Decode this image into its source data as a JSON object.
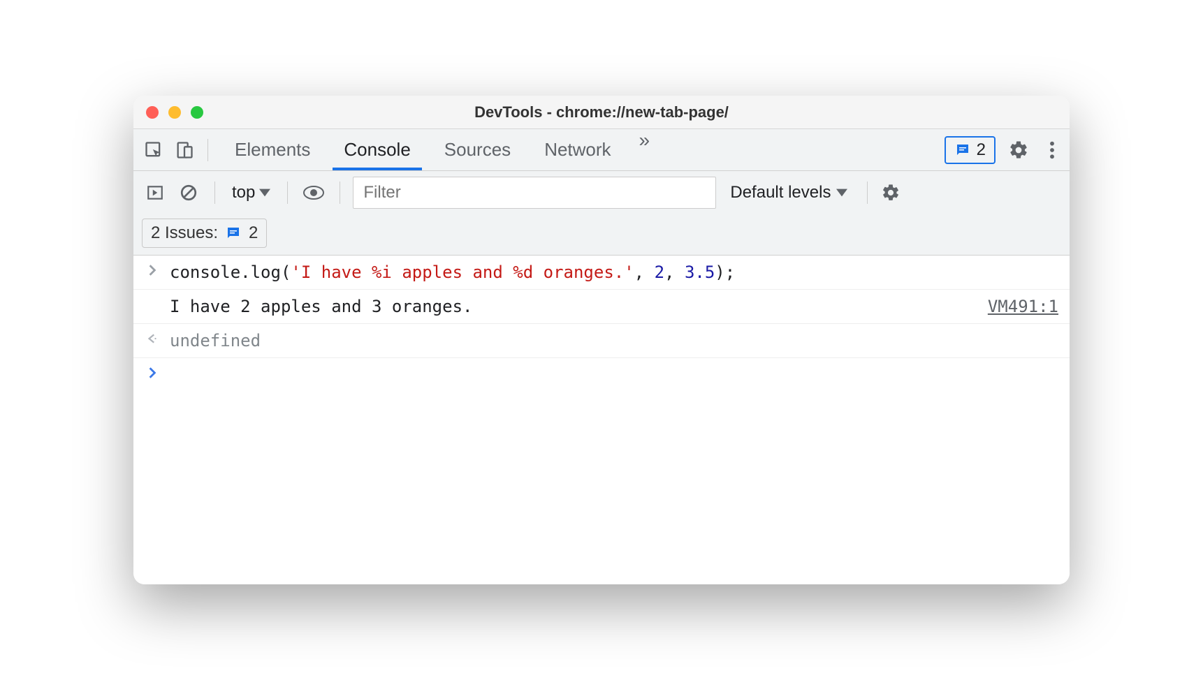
{
  "window": {
    "title": "DevTools - chrome://new-tab-page/"
  },
  "tabs": {
    "elements": "Elements",
    "console": "Console",
    "sources": "Sources",
    "network": "Network",
    "overflow": "»"
  },
  "issues_badge": {
    "count": "2"
  },
  "console_toolbar": {
    "context": "top",
    "filter_placeholder": "Filter",
    "levels_label": "Default levels"
  },
  "issues_panel": {
    "label": "2 Issues:",
    "count": "2"
  },
  "console": {
    "input_prefix": "console.log(",
    "input_string": "'I have %i apples and %d oranges.'",
    "input_sep1": ", ",
    "input_arg1": "2",
    "input_sep2": ", ",
    "input_arg2": "3.5",
    "input_suffix": ");",
    "output": "I have 2 apples and 3 oranges.",
    "source_link": "VM491:1",
    "return_value": "undefined"
  }
}
